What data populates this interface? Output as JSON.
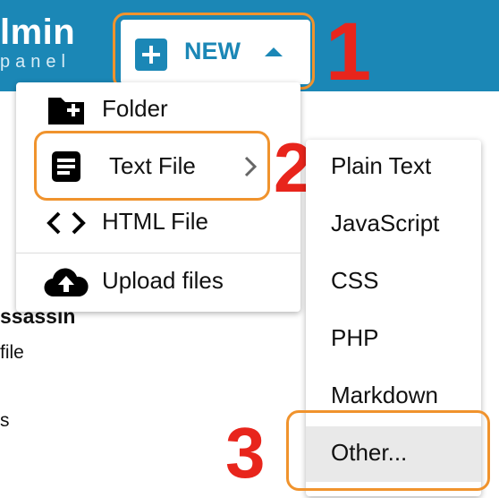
{
  "brand": {
    "main": "lmin",
    "sub": "panel"
  },
  "new_button": {
    "label": "NEW"
  },
  "steps": [
    "1",
    "2",
    "3"
  ],
  "menu": {
    "items": [
      {
        "label": "Folder",
        "icon": "folder-plus-icon"
      },
      {
        "label": "Text File",
        "icon": "text-file-icon",
        "has_submenu": true
      },
      {
        "label": "HTML File",
        "icon": "code-icon"
      },
      {
        "label": "Upload files",
        "icon": "cloud-upload-icon"
      }
    ]
  },
  "submenu": {
    "items": [
      {
        "label": "Plain Text"
      },
      {
        "label": "JavaScript"
      },
      {
        "label": "CSS"
      },
      {
        "label": "PHP"
      },
      {
        "label": "Markdown"
      },
      {
        "label": "Other...",
        "hovered": true
      }
    ]
  },
  "background": {
    "name_fragment": "ssassin",
    "type_fragment": "file",
    "fragment3": "s"
  },
  "colors": {
    "topbar": "#1b87b6",
    "accent": "#1b87b6",
    "highlight_box": "#f0932d",
    "step_number": "#e8251c",
    "hover": "#e9e9e9"
  }
}
